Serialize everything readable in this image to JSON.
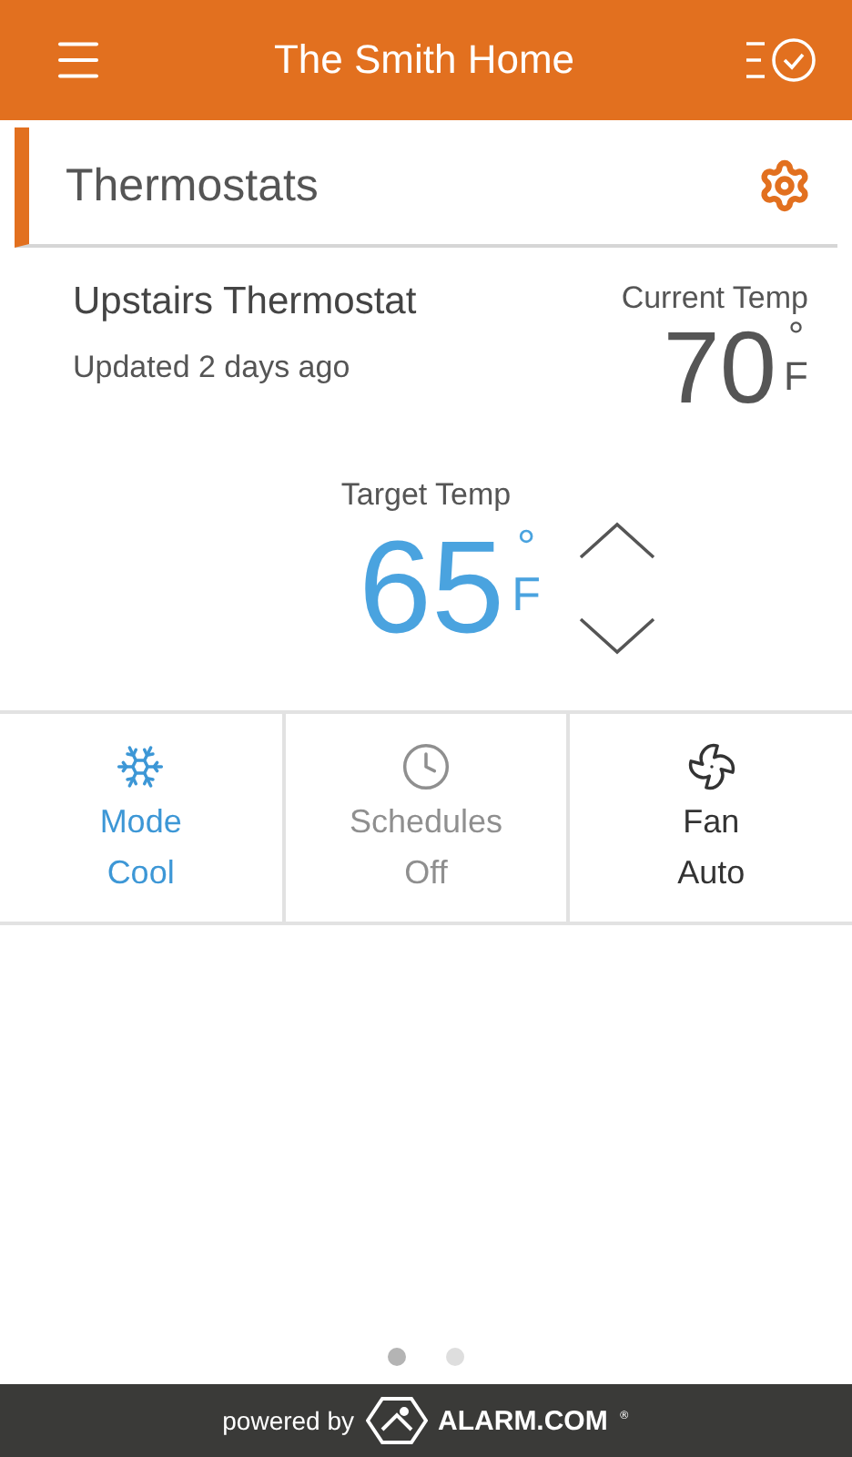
{
  "header": {
    "title": "The Smith Home"
  },
  "section": {
    "title": "Thermostats"
  },
  "thermostat": {
    "name": "Upstairs Thermostat",
    "updated": "Updated 2 days ago",
    "current_label": "Current Temp",
    "current_value": "70",
    "current_degree": "°",
    "current_unit": "F"
  },
  "target": {
    "label": "Target Temp",
    "value": "65",
    "degree": "°",
    "unit": "F"
  },
  "tiles": [
    {
      "kind": "mode",
      "label": "Mode",
      "value": "Cool",
      "disabled": false
    },
    {
      "kind": "schedule",
      "label": "Schedules",
      "value": "Off",
      "disabled": true
    },
    {
      "kind": "fan",
      "label": "Fan",
      "value": "Auto",
      "disabled": false
    }
  ],
  "pages": [
    {
      "selected": true
    },
    {
      "selected": false
    }
  ],
  "footer": {
    "prefix": "powered by",
    "brand": "ALARM.COM",
    "mark": "®"
  }
}
